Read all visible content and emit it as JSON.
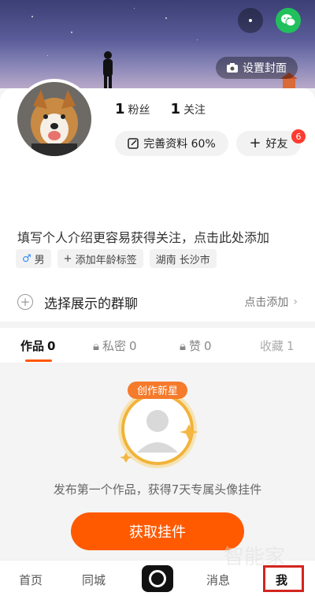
{
  "header": {
    "more_icon": "more-dots-icon",
    "wechat_icon": "wechat-icon",
    "set_cover_label": "设置封面"
  },
  "profile": {
    "stats": {
      "followers_count": "1",
      "followers_label": "粉丝",
      "following_count": "1",
      "following_label": "关注"
    },
    "complete_profile_label": "完善资料 60%",
    "add_friend_label": "好友",
    "friend_badge": "6",
    "bio_placeholder": "填写个人介绍更容易获得关注，点击此处添加",
    "tags": {
      "gender": "男",
      "add_age": "添加年龄标签",
      "location": "湖南 长沙市"
    }
  },
  "group_row": {
    "title": "选择展示的群聊",
    "action": "点击添加"
  },
  "tabs": {
    "works": {
      "label": "作品",
      "count": "0"
    },
    "private": {
      "label": "私密",
      "count": "0"
    },
    "likes": {
      "label": "赞",
      "count": "0"
    },
    "favorites": {
      "label": "收藏",
      "count": "1"
    }
  },
  "empty": {
    "badge_text": "创作新星",
    "message": "发布第一个作品，获得7天专属头像挂件",
    "button_label": "获取挂件"
  },
  "bottom_nav": {
    "home": "首页",
    "local": "同城",
    "messages": "消息",
    "me": "我"
  },
  "watermark": "智能家",
  "colors": {
    "accent": "#ff5a00",
    "badge": "#ff3b30",
    "wechat": "#20c05c",
    "highlight_box": "#d3251f"
  }
}
